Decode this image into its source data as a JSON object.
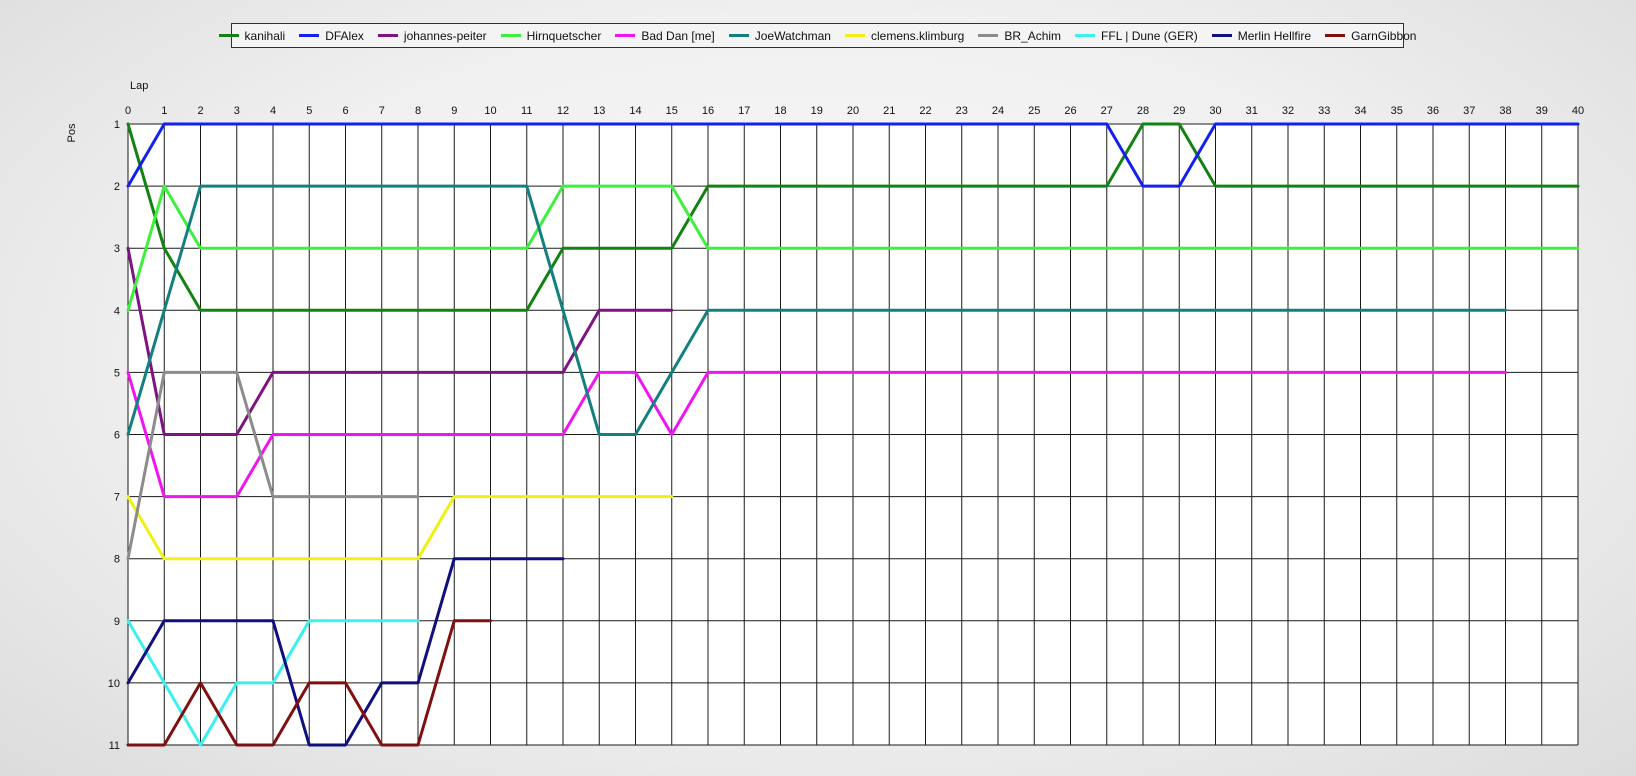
{
  "chart_data": {
    "type": "line",
    "xlabel": "Lap",
    "ylabel": "Pos",
    "xlim": [
      0,
      40
    ],
    "ylim": [
      1,
      11
    ],
    "y_inverted": true,
    "grid": true,
    "legend_position": "top",
    "x_ticks": [
      0,
      1,
      2,
      3,
      4,
      5,
      6,
      7,
      8,
      9,
      10,
      11,
      12,
      13,
      14,
      15,
      16,
      17,
      18,
      19,
      20,
      21,
      22,
      23,
      24,
      25,
      26,
      27,
      28,
      29,
      30,
      31,
      32,
      33,
      34,
      35,
      36,
      37,
      38,
      39,
      40
    ],
    "y_ticks": [
      1,
      2,
      3,
      4,
      5,
      6,
      7,
      8,
      9,
      10,
      11
    ],
    "series": [
      {
        "name": "kanihali",
        "color": "#128212",
        "values": [
          1,
          3,
          4,
          4,
          4,
          4,
          4,
          4,
          4,
          4,
          4,
          4,
          3,
          3,
          3,
          3,
          2,
          2,
          2,
          2,
          2,
          2,
          2,
          2,
          2,
          2,
          2,
          2,
          1,
          1,
          2,
          2,
          2,
          2,
          2,
          2,
          2,
          2,
          2,
          2,
          2
        ]
      },
      {
        "name": "DFAlex",
        "color": "#1420f0",
        "values": [
          2,
          1,
          1,
          1,
          1,
          1,
          1,
          1,
          1,
          1,
          1,
          1,
          1,
          1,
          1,
          1,
          1,
          1,
          1,
          1,
          1,
          1,
          1,
          1,
          1,
          1,
          1,
          1,
          2,
          2,
          1,
          1,
          1,
          1,
          1,
          1,
          1,
          1,
          1,
          1,
          1
        ]
      },
      {
        "name": "johannes-peiter",
        "color": "#7d1480",
        "values": [
          3,
          6,
          6,
          6,
          5,
          5,
          5,
          5,
          5,
          5,
          5,
          5,
          5,
          4,
          4,
          4
        ]
      },
      {
        "name": "Hirnquetscher",
        "color": "#3cf03c",
        "values": [
          4,
          2,
          3,
          3,
          3,
          3,
          3,
          3,
          3,
          3,
          3,
          3,
          2,
          2,
          2,
          2,
          3,
          3,
          3,
          3,
          3,
          3,
          3,
          3,
          3,
          3,
          3,
          3,
          3,
          3,
          3,
          3,
          3,
          3,
          3,
          3,
          3,
          3,
          3,
          3,
          3
        ]
      },
      {
        "name": "Bad Dan [me]",
        "color": "#f014f0",
        "values": [
          5,
          7,
          7,
          7,
          6,
          6,
          6,
          6,
          6,
          6,
          6,
          6,
          6,
          5,
          5,
          6,
          5,
          5,
          5,
          5,
          5,
          5,
          5,
          5,
          5,
          5,
          5,
          5,
          5,
          5,
          5,
          5,
          5,
          5,
          5,
          5,
          5,
          5,
          5
        ]
      },
      {
        "name": "JoeWatchman",
        "color": "#12807e",
        "values": [
          6,
          4,
          2,
          2,
          2,
          2,
          2,
          2,
          2,
          2,
          2,
          2,
          4,
          6,
          6,
          5,
          4,
          4,
          4,
          4,
          4,
          4,
          4,
          4,
          4,
          4,
          4,
          4,
          4,
          4,
          4,
          4,
          4,
          4,
          4,
          4,
          4,
          4,
          4
        ]
      },
      {
        "name": "clemens.klimburg",
        "color": "#f0f014",
        "values": [
          7,
          8,
          8,
          8,
          8,
          8,
          8,
          8,
          8,
          7,
          7,
          7,
          7,
          7,
          7,
          7
        ]
      },
      {
        "name": "BR_Achim",
        "color": "#8c8c8c",
        "values": [
          8,
          5,
          5,
          5,
          7,
          7,
          7,
          7,
          7
        ]
      },
      {
        "name": "FFL | Dune (GER)",
        "color": "#3cf0f0",
        "values": [
          9,
          10,
          11,
          10,
          10,
          9,
          9,
          9,
          9
        ]
      },
      {
        "name": "Merlin Hellfire",
        "color": "#0f0f80",
        "values": [
          10,
          9,
          9,
          9,
          9,
          11,
          11,
          10,
          10,
          8,
          8,
          8,
          8
        ]
      },
      {
        "name": "GarnGibbon",
        "color": "#800f0f",
        "values": [
          11,
          11,
          10,
          11,
          11,
          10,
          10,
          11,
          11,
          9,
          9
        ]
      }
    ]
  }
}
